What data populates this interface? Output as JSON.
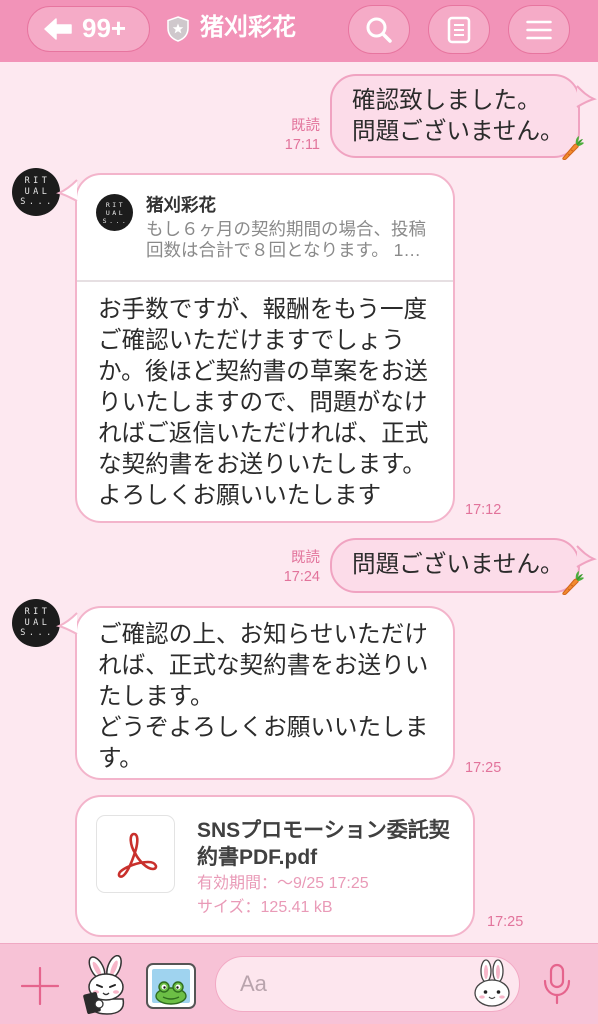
{
  "theme": {
    "header_bg": "#f293b8",
    "chat_bg": "#fde8f0",
    "accent": "#e2739b",
    "outgoing_bubble": "#fcdce9",
    "incoming_bubble": "#ffffff",
    "composer_bg": "#f7c2d6"
  },
  "header": {
    "back_icon": "arrow-left-icon",
    "unread_count": "99+",
    "badge_icon": "shield-star-icon",
    "title": "猪刈彩花",
    "search_icon": "search-icon",
    "notes_icon": "notes-icon",
    "menu_icon": "menu-icon"
  },
  "messages": [
    {
      "direction": "outgoing",
      "lines": [
        "確認致しました。",
        "問題ございません。"
      ],
      "read_status": "既読",
      "time": "17:11",
      "decoration_icon": "carrot-icon"
    },
    {
      "direction": "incoming",
      "avatar_text": [
        "RIT",
        "UAL",
        "S..."
      ],
      "reply": {
        "sender": "猪刈彩花",
        "lines": [
          "もし６ヶ月の契約期間の場合、投稿",
          "回数は合計で８回となります。 1…"
        ]
      },
      "lines": [
        "お手数ですが、報酬をもう一度",
        "ご確認いただけますでしょう",
        "か。後ほど契約書の草案をお送",
        "りいたしますので、問題がなけ",
        "ればご返信いただければ、正式",
        "な契約書をお送りいたします。",
        "よろしくお願いいたします"
      ],
      "time": "17:12"
    },
    {
      "direction": "outgoing",
      "lines": [
        "問題ございません。"
      ],
      "read_status": "既読",
      "time": "17:24",
      "decoration_icon": "carrot-icon"
    },
    {
      "direction": "incoming",
      "avatar_text": [
        "RIT",
        "UAL",
        "S..."
      ],
      "lines": [
        "ご確認の上、お知らせいただけ",
        "れば、正式な契約書をお送りい",
        "たします。",
        "どうぞよろしくお願いいたしま",
        "す。"
      ],
      "time": "17:25"
    },
    {
      "direction": "incoming",
      "file": {
        "icon": "pdf-icon",
        "name_lines": [
          "SNSプロモーション委託契",
          "約書PDF.pdf"
        ],
        "expiry": "有効期間：〜9/25 17:25",
        "size": "サイズ：125.41 kB"
      },
      "time": "17:25"
    }
  ],
  "composer": {
    "add_icon": "plus-icon",
    "sticker_icon": "sticker-icon",
    "photo_icon": "photo-icon",
    "placeholder": "Aa",
    "emoji_icon": "emoji-icon",
    "voice_icon": "microphone-icon"
  }
}
